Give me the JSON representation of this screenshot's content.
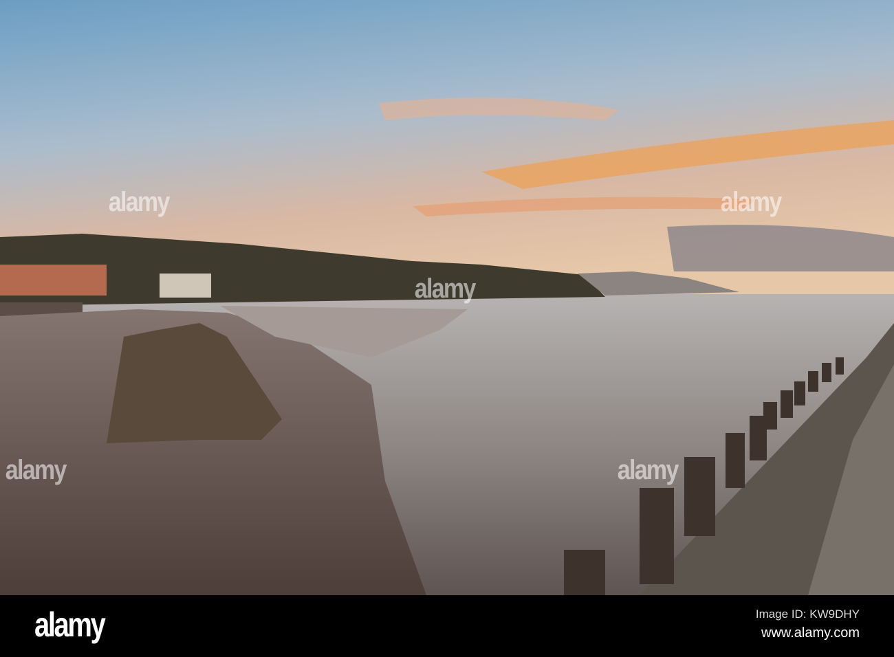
{
  "photo": {
    "watermark": "alamy",
    "colors": {
      "sky_top": "#6fa2c6",
      "sky_glow": "#f3a65a",
      "sea": "#8a8682",
      "sand": "#6e5c55"
    }
  },
  "footer": {
    "logo": "alamy",
    "image_id": "Image ID: KW9DHY",
    "website": "www.alamy.com"
  }
}
